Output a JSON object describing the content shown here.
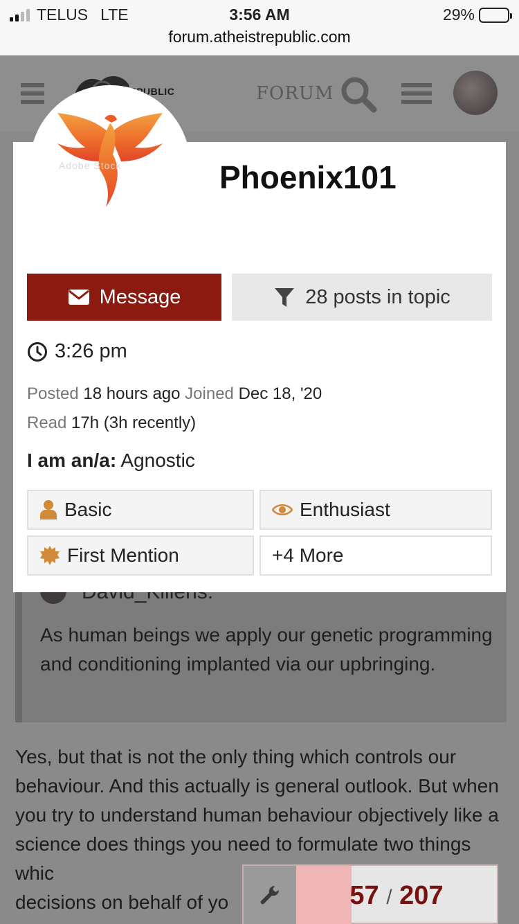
{
  "status_bar": {
    "carrier": "TELUS",
    "network": "LTE",
    "time": "3:56 AM",
    "battery": "29%",
    "battery_level": 0.29,
    "url": "forum.atheistrepublic.com"
  },
  "header": {
    "logo_text": "ATHEIST REPUBLIC",
    "forum_label": "FORUM"
  },
  "profile_card": {
    "username": "Phoenix101",
    "avatar_watermark": "Adobe Stock",
    "message_button": "Message",
    "posts_button": "28 posts in topic",
    "local_time": "3:26 pm",
    "posted_label": "Posted",
    "posted_value": "18 hours ago",
    "joined_label": "Joined",
    "joined_value": "Dec 18, '20",
    "read_label": "Read",
    "read_value": "17h (3h recently)",
    "belief_label": "I am an/a:",
    "belief_value": "Agnostic",
    "badges": [
      {
        "label": "Basic",
        "icon": "person-icon"
      },
      {
        "label": "Enthusiast",
        "icon": "eye-icon"
      },
      {
        "label": "First Mention",
        "icon": "badge-icon"
      },
      {
        "label": "+4 More",
        "icon": ""
      }
    ]
  },
  "post": {
    "quote_author": "David_Killens:",
    "quote_text": "As human beings we apply our genetic programming and conditioning implanted via our upbringing.",
    "body_text": "Yes, but that is not the only thing which controls our behaviour. And this actually is general outlook. But when you try to understand human behaviour objectively like a science does things you need to formulate two things whic",
    "body_text_line6": "decisions on behalf of yo"
  },
  "progress": {
    "current": "57",
    "separator": "/",
    "total": "207",
    "fraction": 0.2754
  },
  "colors": {
    "accent": "#8b1a10",
    "badge_icon": "#d08a3a",
    "dim_overlay": "#8a8a8a"
  }
}
